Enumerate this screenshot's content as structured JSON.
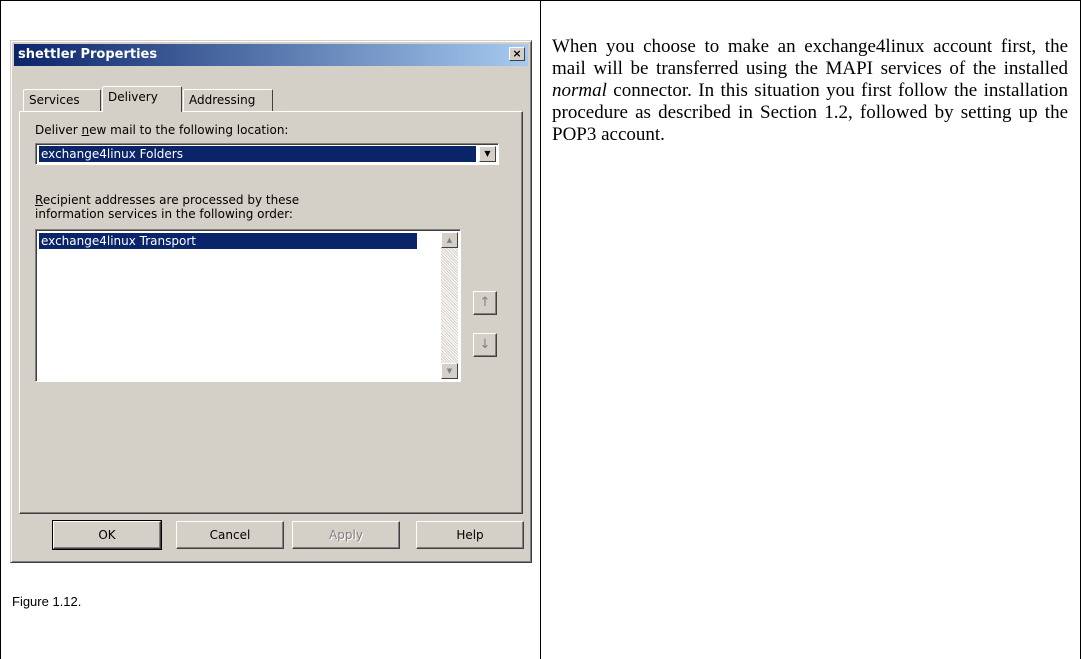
{
  "dialog": {
    "title": "shettler Properties",
    "close_glyph": "×",
    "tabs": [
      {
        "label": "Services"
      },
      {
        "label": "Delivery"
      },
      {
        "label": "Addressing"
      }
    ],
    "deliver_label_pre": "Deliver ",
    "deliver_label_ul": "n",
    "deliver_label_post": "ew mail to the following location:",
    "deliver_location": "exchange4linux Folders",
    "recipient_label_ul": "R",
    "recipient_label_line1": "ecipient addresses are processed by these",
    "recipient_label_line2": "information services in the following order:",
    "services": [
      "exchange4linux Transport"
    ],
    "move_up_icon": "up-arrow-icon",
    "move_down_icon": "down-arrow-icon",
    "buttons": {
      "ok": "OK",
      "cancel": "Cancel",
      "apply": "Apply",
      "help": "Help"
    }
  },
  "caption": "Figure 1.12.",
  "paragraph": {
    "part1": "When you choose to make an exchange4linux account first, the mail will be transferred using the MAPI services of the installed ",
    "emph": "normal",
    "part2": " connector. In this situation you first follow the installation procedure as described in Section 1.2, followed by setting up the POP3 account."
  },
  "colors": {
    "titlebar": "#0a246a",
    "dialog_face": "#d4d0c8",
    "selection": "#0a246a"
  }
}
